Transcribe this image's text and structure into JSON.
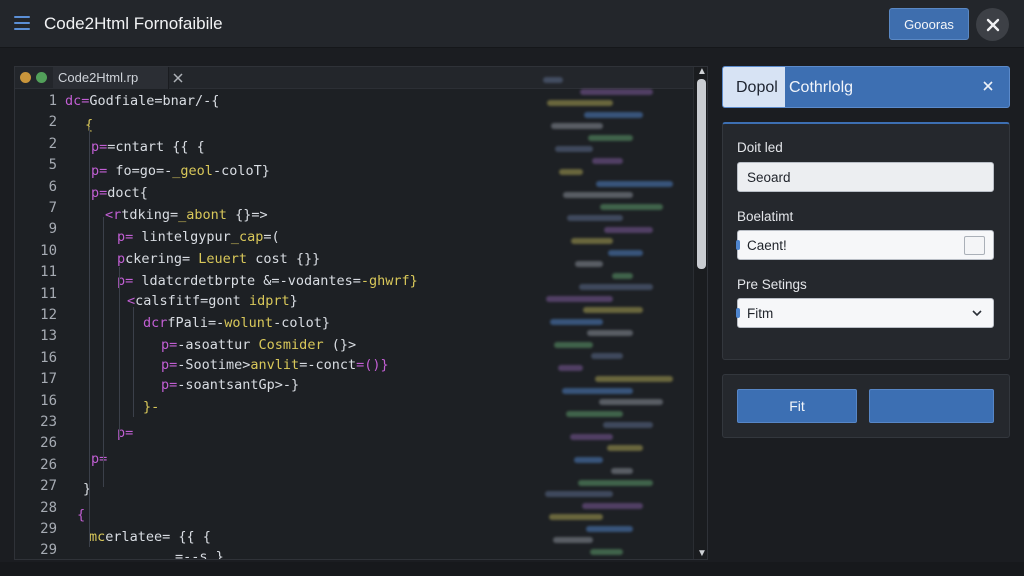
{
  "header": {
    "title": "Code2Html Fornofaibile",
    "button_label": "Goooras"
  },
  "editor": {
    "tab_label": "Code2Html.rp",
    "line_numbers": [
      "1",
      "2",
      "2",
      "5",
      "6",
      "7",
      "9",
      "10",
      "11",
      "11",
      "12",
      "13",
      "16",
      "17",
      "16",
      "23",
      "26",
      "26",
      "27",
      "28",
      "29",
      "29"
    ],
    "lines": [
      [
        [
          "kw",
          "dc="
        ],
        [
          "tx",
          "Godfiale=bnar/-{"
        ]
      ],
      [
        [
          "yl",
          "{"
        ]
      ],
      [
        [
          "kw",
          "p="
        ],
        [
          "tx",
          "=cntart {{ {"
        ]
      ],
      [
        [
          "kw",
          "p="
        ],
        [
          "tx",
          " fo=go=-"
        ],
        [
          "yl",
          "_geol"
        ],
        [
          "tx",
          "-coloT}"
        ]
      ],
      [
        [
          "kw",
          "p="
        ],
        [
          "tx",
          "doct{"
        ]
      ],
      [
        [
          "kw",
          "<r"
        ],
        [
          "tx",
          "tdking="
        ],
        [
          "yl",
          "_abont"
        ],
        [
          "tx",
          " {}=>"
        ]
      ],
      [
        [
          "kw",
          "p="
        ],
        [
          "tx",
          " lintelgypur"
        ],
        [
          "yl",
          "_cap"
        ],
        [
          "tx",
          "=("
        ]
      ],
      [
        [
          "kw",
          "p"
        ],
        [
          "tx",
          "ckering= "
        ],
        [
          "yl",
          "Leuert"
        ],
        [
          "tx",
          " cost {}}"
        ]
      ],
      [
        [
          "kw",
          "p="
        ],
        [
          "tx",
          " ldatcrdetbrpte &=-vodantes="
        ],
        [
          "yl",
          "-ghwrf}"
        ]
      ],
      [
        [
          "kw",
          "<"
        ],
        [
          "tx",
          "calsfitf=gont "
        ],
        [
          "yl",
          "idprt"
        ],
        [
          "tx",
          "}"
        ]
      ],
      [
        [
          "kw",
          "dcr"
        ],
        [
          "tx",
          "fPali=-"
        ],
        [
          "yl",
          "wolunt"
        ],
        [
          "tx",
          "-colot}"
        ]
      ],
      [
        [
          "kw",
          "p="
        ],
        [
          "tx",
          "-asoattur "
        ],
        [
          "yl",
          "Cosmider"
        ],
        [
          "tx",
          " (}>"
        ]
      ],
      [
        [
          "kw",
          "p="
        ],
        [
          "tx",
          "-Sootime>"
        ],
        [
          "yl",
          "anvlit"
        ],
        [
          "tx",
          "=-conct"
        ],
        [
          "kw",
          "=()}"
        ]
      ],
      [
        [
          "kw",
          "p="
        ],
        [
          "tx",
          "-soantsantGp>-}"
        ]
      ],
      [
        [
          "yl",
          "}-"
        ]
      ],
      [
        [
          "kw",
          "p="
        ]
      ],
      [
        [
          "kw",
          "p="
        ]
      ],
      [
        [
          "tx",
          "}"
        ]
      ],
      [
        [
          "kw",
          "{"
        ]
      ],
      [
        [
          "yl",
          "mc"
        ],
        [
          "tx",
          "erlatee= {{ {"
        ]
      ],
      [
        [
          "tx",
          "=--s }"
        ]
      ]
    ]
  },
  "dialog": {
    "tab_active": "Dopol",
    "tab_other": "Cothrlolg",
    "field1_label": "Doit led",
    "field1_value": "Seoard",
    "field2_label": "Boelatimt",
    "field2_value": "Caent!",
    "field3_label": "Pre Setings",
    "field3_value": "Fitm",
    "button_primary": "Fit",
    "button_secondary": ""
  },
  "colors": {
    "accent": "#3d6fb2",
    "keyword": "#c25fd4",
    "string": "#d9c85a",
    "background": "#1b1d21"
  }
}
